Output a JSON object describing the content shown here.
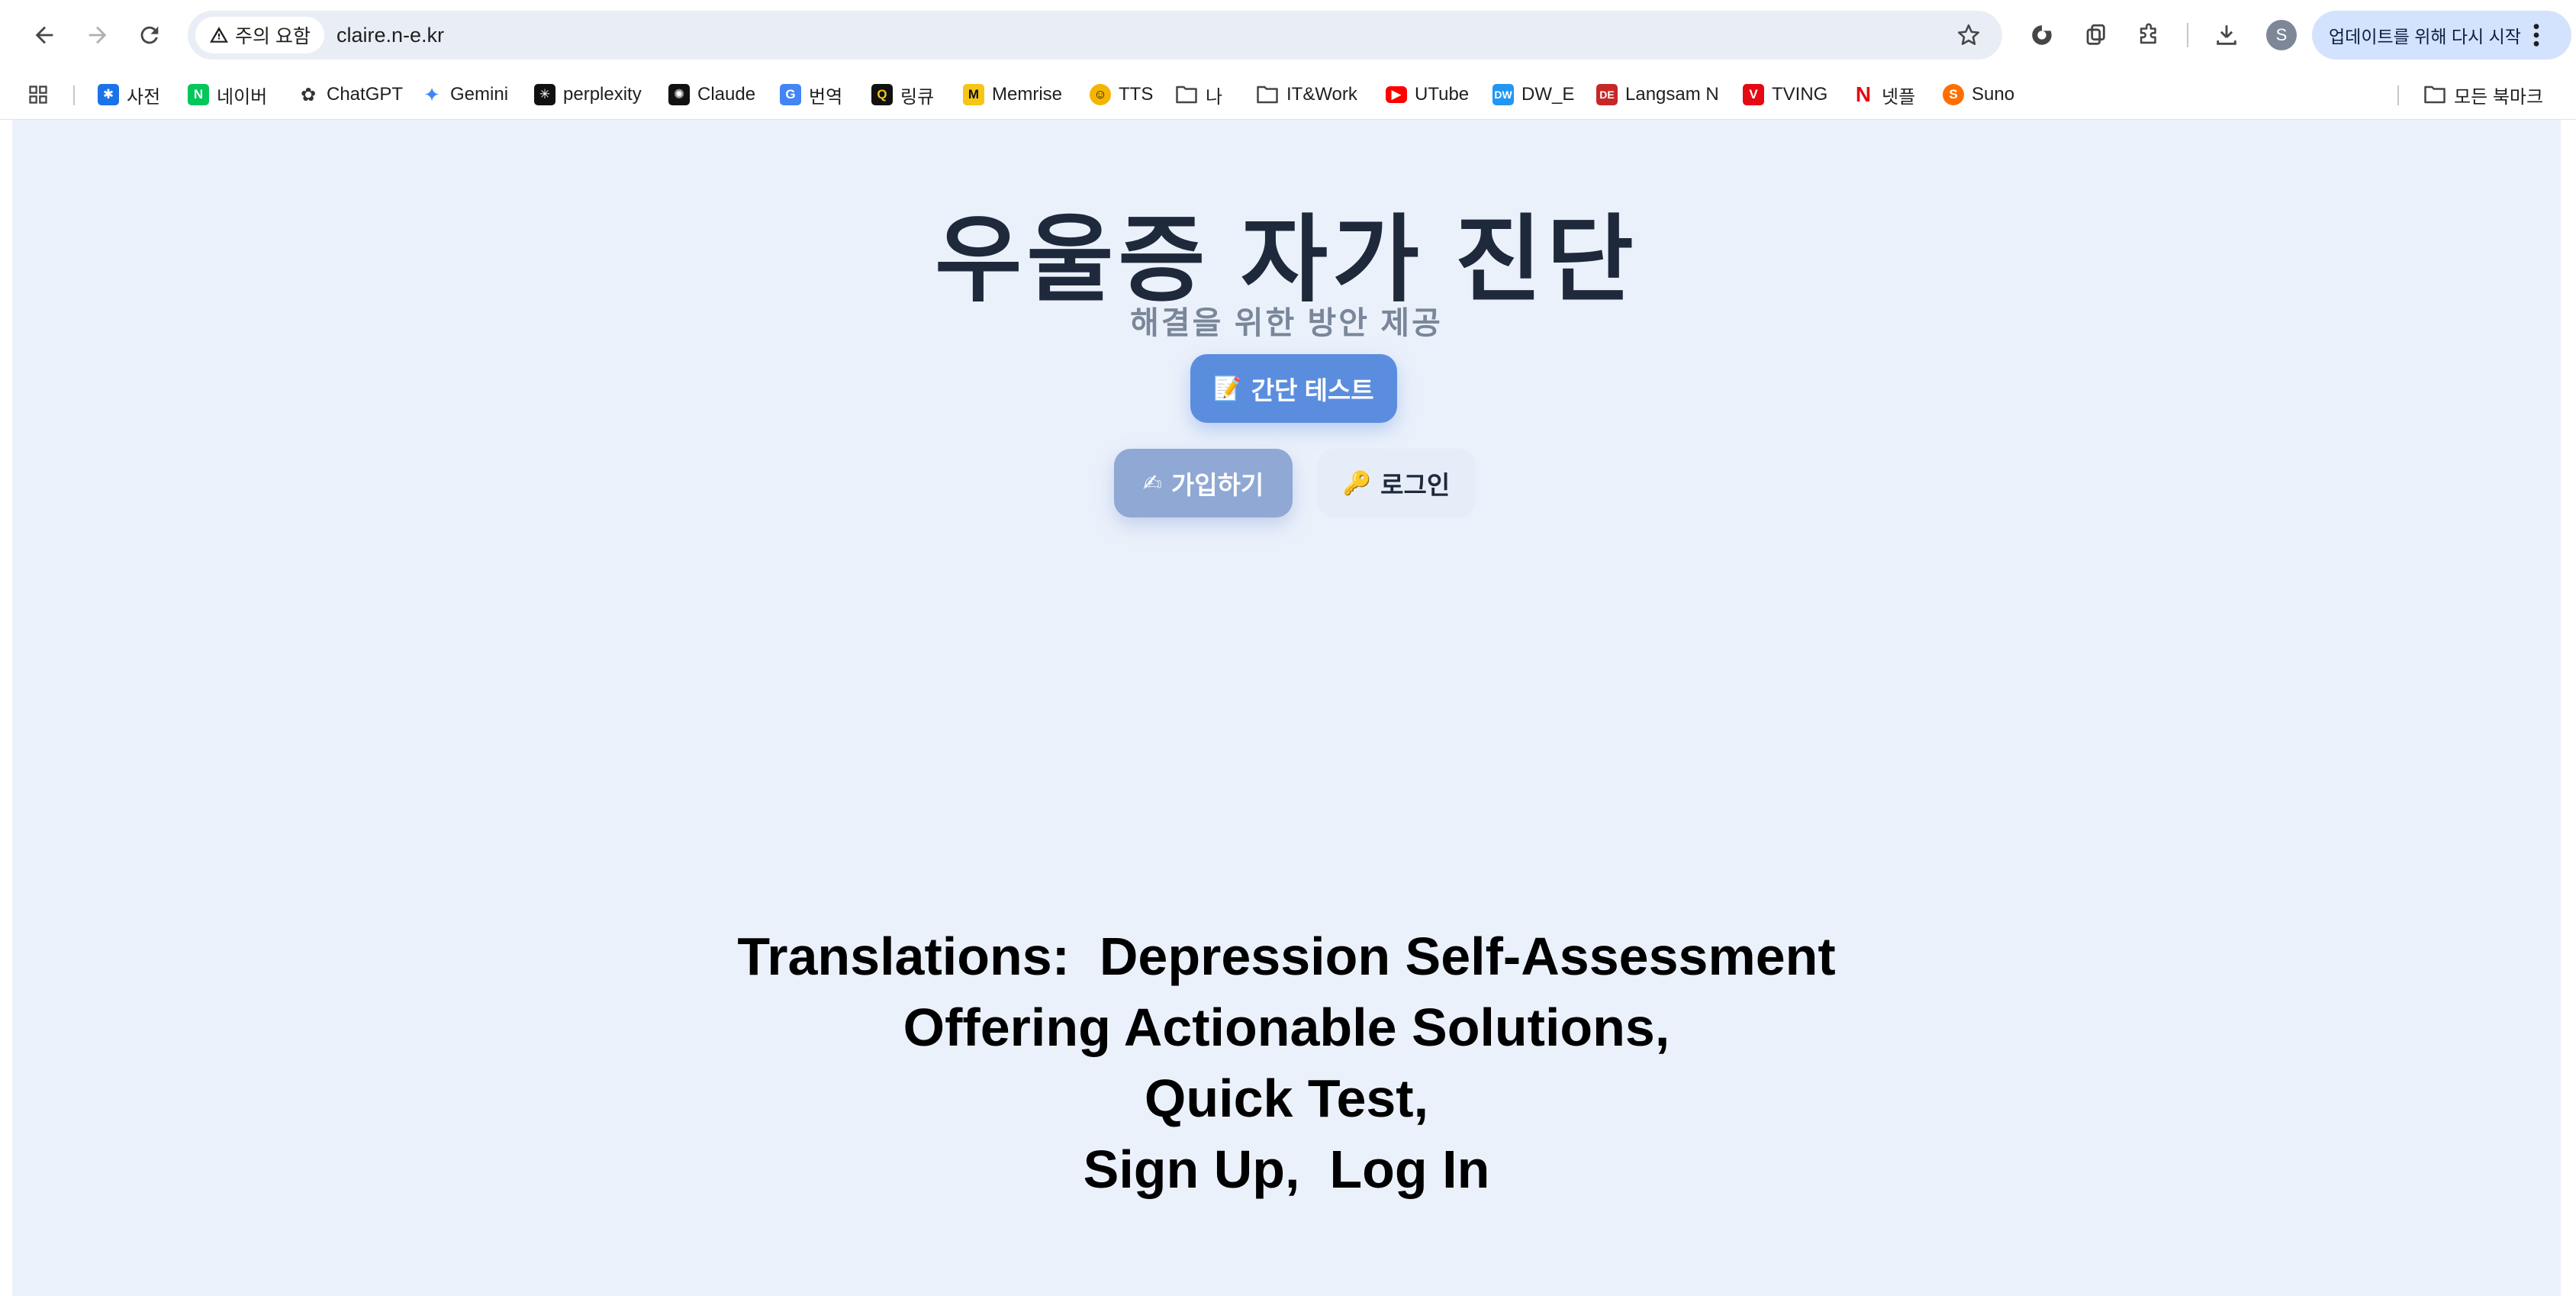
{
  "browser": {
    "security_label": "주의 요함",
    "url": "claire.n-e.kr",
    "update_button_label": "업데이트를 위해 다시 시작",
    "profile_initial": "S"
  },
  "bookmarks": {
    "items": [
      {
        "label": "사전",
        "icon": "dictionary-icon",
        "color": "#1a73e8"
      },
      {
        "label": "네이버",
        "icon": "naver-icon",
        "color": "#03c75a"
      },
      {
        "label": "ChatGPT",
        "icon": "chatgpt-icon",
        "color": "#333333"
      },
      {
        "label": "Gemini",
        "icon": "gemini-icon",
        "color": "#4285f4"
      },
      {
        "label": "perplexity",
        "icon": "perplexity-icon",
        "color": "#111111"
      },
      {
        "label": "Claude",
        "icon": "claude-icon",
        "color": "#111111"
      },
      {
        "label": "번역",
        "icon": "translate-icon",
        "color": "#4285f4"
      },
      {
        "label": "링큐",
        "icon": "linkq-icon",
        "color": "#111111"
      },
      {
        "label": "Memrise",
        "icon": "memrise-icon",
        "color": "#f5c518"
      },
      {
        "label": "TTS",
        "icon": "tts-icon",
        "color": "#f4b400"
      },
      {
        "label": "나",
        "icon": "folder-icon",
        "color": "#444746"
      },
      {
        "label": "IT&Work",
        "icon": "folder-icon",
        "color": "#444746"
      },
      {
        "label": "UTube",
        "icon": "youtube-icon",
        "color": "#ff0000"
      },
      {
        "label": "DW_E",
        "icon": "dw-icon",
        "color": "#2196f3"
      },
      {
        "label": "Langsam N",
        "icon": "langsam-icon",
        "color": "#c62828"
      },
      {
        "label": "TVING",
        "icon": "tving-icon",
        "color": "#e50914"
      },
      {
        "label": "넷플",
        "icon": "netflix-icon",
        "color": "#e50914"
      },
      {
        "label": "Suno",
        "icon": "suno-icon",
        "color": "#ff6f00"
      }
    ],
    "all_bookmarks_label": "모든 북마크"
  },
  "page": {
    "title": "우울증 자가 진단",
    "subtitle": "해결을 위한 방안 제공",
    "quick_test_label": "간단 테스트",
    "signup_label": "가입하기",
    "login_label": "로그인",
    "translation_lines": [
      "Translations:  Depression Self-Assessment",
      "Offering Actionable Solutions,",
      "Quick Test,",
      "Sign Up,  Log In"
    ]
  },
  "colors": {
    "page_background": "#ebf1fb",
    "primary_button": "#5b8ddf",
    "signup_button": "#8fa8d4",
    "title_text": "#1e293b"
  }
}
